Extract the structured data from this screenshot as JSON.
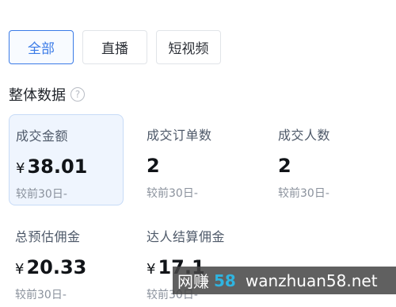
{
  "tabs": [
    {
      "label": "全部",
      "active": true
    },
    {
      "label": "直播",
      "active": false
    },
    {
      "label": "短视频",
      "active": false
    }
  ],
  "section": {
    "title": "整体数据",
    "help_icon": "question-circle-icon"
  },
  "metrics": [
    {
      "label": "成交金额",
      "currency": "¥",
      "value": "38.01",
      "compare": "较前30日-",
      "selected": true
    },
    {
      "label": "成交订单数",
      "currency": "",
      "value": "2",
      "compare": "较前30日-",
      "selected": false
    },
    {
      "label": "成交人数",
      "currency": "",
      "value": "2",
      "compare": "较前30日-",
      "selected": false
    },
    {
      "label": "总预估佣金",
      "currency": "¥",
      "value": "20.33",
      "compare": "较前30日-",
      "selected": false
    },
    {
      "label": "达人结算佣金",
      "currency": "¥",
      "value": "17.1",
      "compare": "较前30日-",
      "selected": false
    }
  ],
  "watermark": {
    "prefix": "网赚",
    "number": "58",
    "domain": "wanzhuan58.net"
  },
  "colors": {
    "accent": "#3b7be7",
    "selected_card_bg": "#eff5fe"
  }
}
